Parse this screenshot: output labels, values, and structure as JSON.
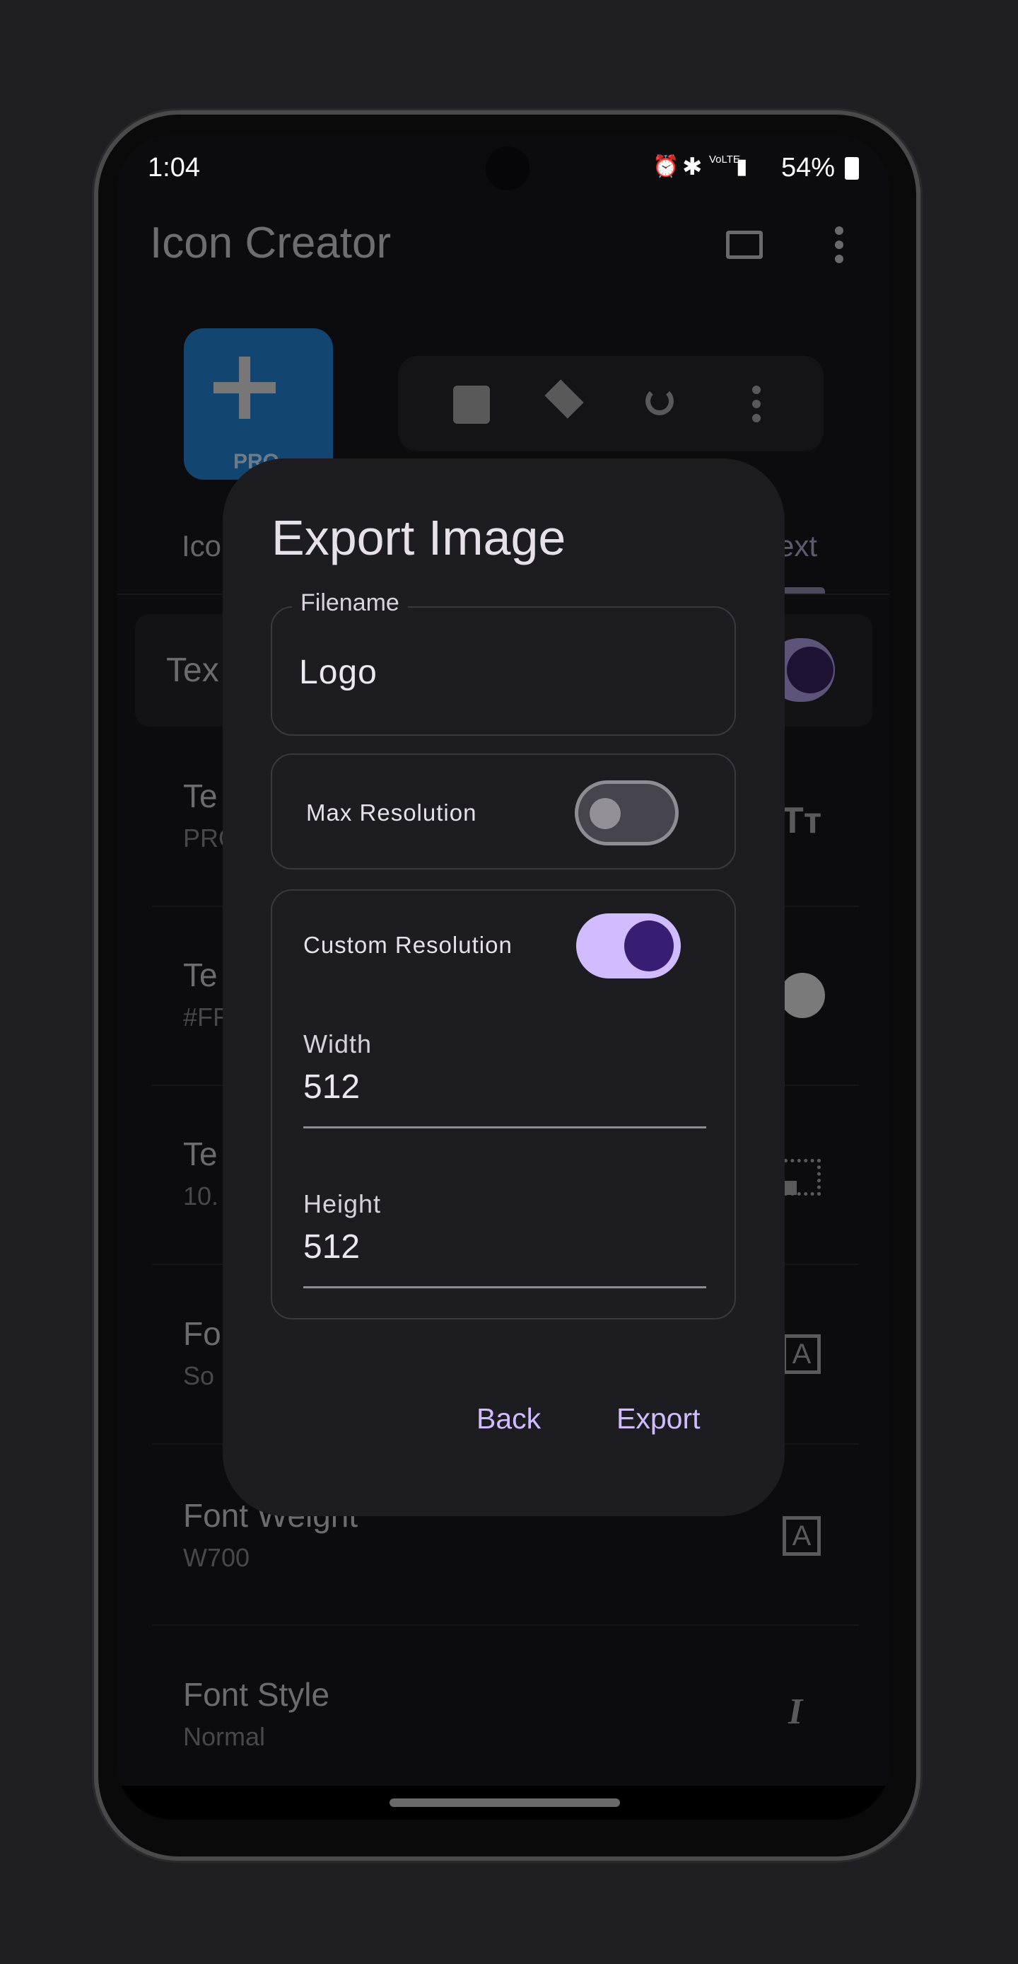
{
  "status_bar": {
    "time": "1:04",
    "battery": "54%",
    "network": "VoLTE"
  },
  "app_bar": {
    "title": "Icon Creator"
  },
  "preview": {
    "badge_partial": "PRO"
  },
  "tabs": [
    {
      "label_partial": "Ico"
    },
    {
      "label_partial": "ext",
      "selected": true
    }
  ],
  "section": {
    "label_partial": "Tex"
  },
  "list_items": [
    {
      "title_partial": "Te",
      "subtitle_partial": "PRO",
      "icon": "text-fields-icon"
    },
    {
      "title_partial": "Te",
      "subtitle_partial": "#FF",
      "icon": "color-circle-icon"
    },
    {
      "title_partial": "Te",
      "subtitle_partial": "10.",
      "icon": "resize-icon"
    },
    {
      "title_partial": "Fo",
      "subtitle_partial": "So",
      "icon": "font-icon"
    },
    {
      "title": "Font Weight",
      "subtitle": "W700",
      "icon": "font-icon"
    },
    {
      "title": "Font Style",
      "subtitle": "Normal",
      "icon": "italic-icon"
    }
  ],
  "dialog": {
    "title": "Export Image",
    "filename": {
      "label": "Filename",
      "value": "Logo"
    },
    "max_resolution": {
      "label": "Max Resolution",
      "on": false
    },
    "custom_resolution": {
      "label": "Custom Resolution",
      "on": true
    },
    "width": {
      "label": "Width",
      "value": "512"
    },
    "height": {
      "label": "Height",
      "value": "512"
    },
    "back_label": "Back",
    "export_label": "Export"
  },
  "colors": {
    "accent": "#d0bcff",
    "accent_dark": "#381e72",
    "dialog_bg": "#1d1c21",
    "icon_blue": "#124670"
  }
}
